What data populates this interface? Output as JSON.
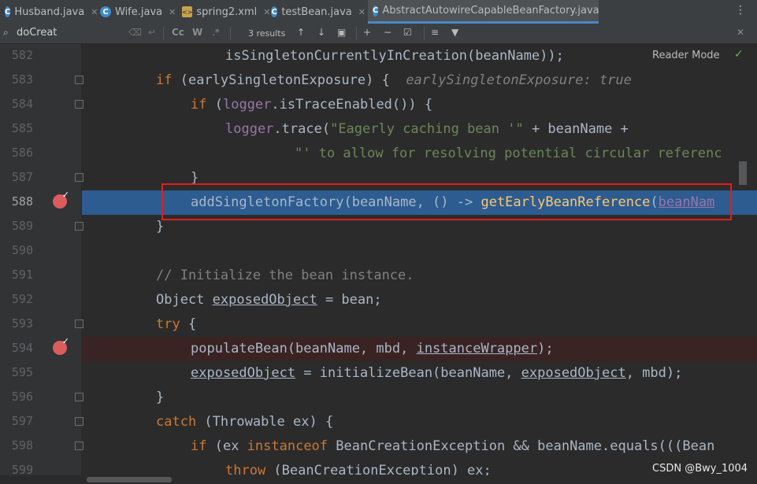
{
  "tabs": [
    {
      "label": "Husband.java",
      "icon": "C",
      "closable": true,
      "active": false
    },
    {
      "label": "Wife.java",
      "icon": "C",
      "closable": true,
      "active": false
    },
    {
      "label": "spring2.xml",
      "icon": "xml",
      "closable": true,
      "active": false
    },
    {
      "label": "testBean.java",
      "icon": "C",
      "closable": true,
      "active": false
    },
    {
      "label": "AbstractAutowireCapableBeanFactory.java",
      "icon": "C",
      "closable": false,
      "active": true
    }
  ],
  "tab_menu_glyph": "⋮",
  "search": {
    "icon": "search-icon",
    "query": "doCreat",
    "case_label": "Cc",
    "words_label": "W",
    "regex_label": ".*",
    "results": "3 results"
  },
  "reader_mode": "Reader Mode",
  "line_numbers": [
    "582",
    "583",
    "584",
    "585",
    "586",
    "587",
    "588",
    "589",
    "590",
    "591",
    "592",
    "593",
    "594",
    "595",
    "596",
    "597",
    "598",
    "599"
  ],
  "current_line": "588",
  "breakpoint_lines": [
    "588",
    "594"
  ],
  "code": {
    "l582": {
      "a": "isSingletonCurrentlyInCreation",
      "b": "(beanName));"
    },
    "l583": {
      "kw": "if",
      "b": " (earlySingletonExposure) {",
      "hint": "earlySingletonExposure: true"
    },
    "l584": {
      "kw": "if",
      "b1": " (",
      "fld": "logger",
      "b2": ".isTraceEnabled()) {"
    },
    "l585": {
      "fld": "logger",
      "b1": ".trace(",
      "str": "\"Eagerly caching bean '\"",
      "b2": " + beanName +"
    },
    "l586": {
      "str": "\"' to allow for resolving potential circular referenc"
    },
    "l587": {
      "b": "}"
    },
    "l588": {
      "a": "addSingletonFactory",
      "b1": "(beanName, () -> ",
      "c": "getEarlyBeanReference",
      "b2": "(",
      "u": "beanNam"
    },
    "l589": {
      "b": "}"
    },
    "l591": {
      "cmt": "// Initialize the bean instance."
    },
    "l592": {
      "a": "Object ",
      "u": "exposedObject",
      "b": " = bean;"
    },
    "l593": {
      "kw": "try",
      "b": " {"
    },
    "l594": {
      "a": "populateBean(beanName, mbd, ",
      "u": "instanceWrapper",
      "b": ");"
    },
    "l595": {
      "u1": "exposedObject",
      "b1": " = initializeBean(beanName, ",
      "u2": "exposedObject",
      "b2": ", mbd);"
    },
    "l596": {
      "b": "}"
    },
    "l597": {
      "kw": "catch",
      "b": " (Throwable ex) {"
    },
    "l598": {
      "kw": "if",
      "b1": " (ex ",
      "kw2": "instanceof",
      "b2": " BeanCreationException && beanName.equals(((Bean"
    },
    "l599": {
      "kw": "throw",
      "b": " (BeanCreationException) ex;"
    }
  },
  "watermark": "CSDN @Bwy_1004",
  "colors": {
    "selection": "#2d5c91",
    "annotation_box": "#e01e1e",
    "breakpoint": "#db5c5c"
  }
}
